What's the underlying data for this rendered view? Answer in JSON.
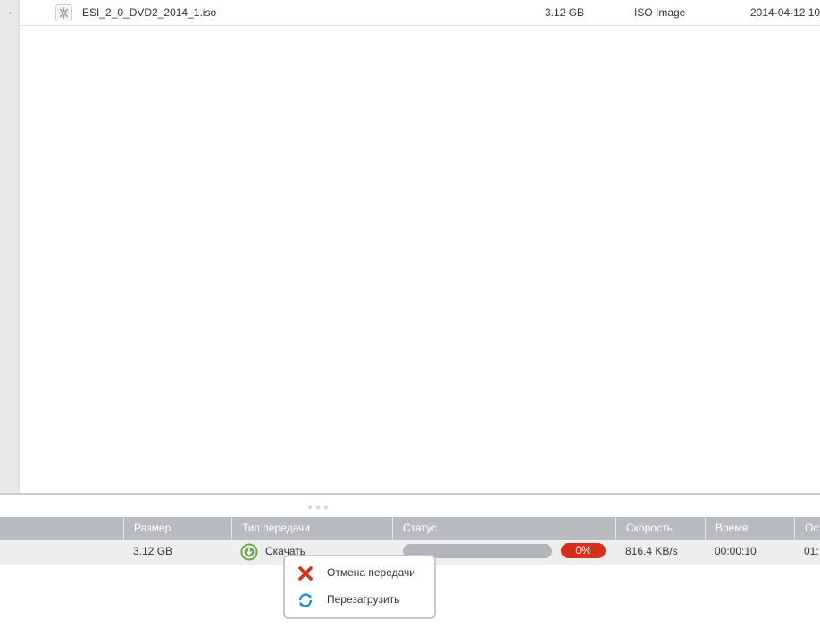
{
  "file_list": {
    "rows": [
      {
        "icon": "gear-file-icon",
        "name": "ESI_2_0_DVD2_2014_1.iso",
        "size": "3.12 GB",
        "type": "ISO Image",
        "date": "2014-04-12 10"
      }
    ]
  },
  "transfers": {
    "columns": {
      "size": "Размер",
      "transfer_type": "Тип передачи",
      "status": "Статус",
      "speed": "Скорость",
      "time": "Время",
      "remaining": "Ост"
    },
    "rows": [
      {
        "size": "3.12 GB",
        "transfer_type": "Скачать",
        "progress_percent": 0,
        "status_badge": "0%",
        "speed": "816.4 KB/s",
        "time": "00:00:10",
        "remaining": "01:"
      }
    ]
  },
  "context_menu": {
    "items": [
      {
        "label": "Отмена передачи",
        "icon": "cancel-x-icon",
        "color": "#d4301b"
      },
      {
        "label": "Перезагрузить",
        "icon": "reload-icon",
        "color": "#1f8fd1"
      }
    ]
  },
  "colors": {
    "header_bg": "#b8bcc1",
    "badge_red": "#d4301b",
    "download_green": "#6aa84f"
  }
}
